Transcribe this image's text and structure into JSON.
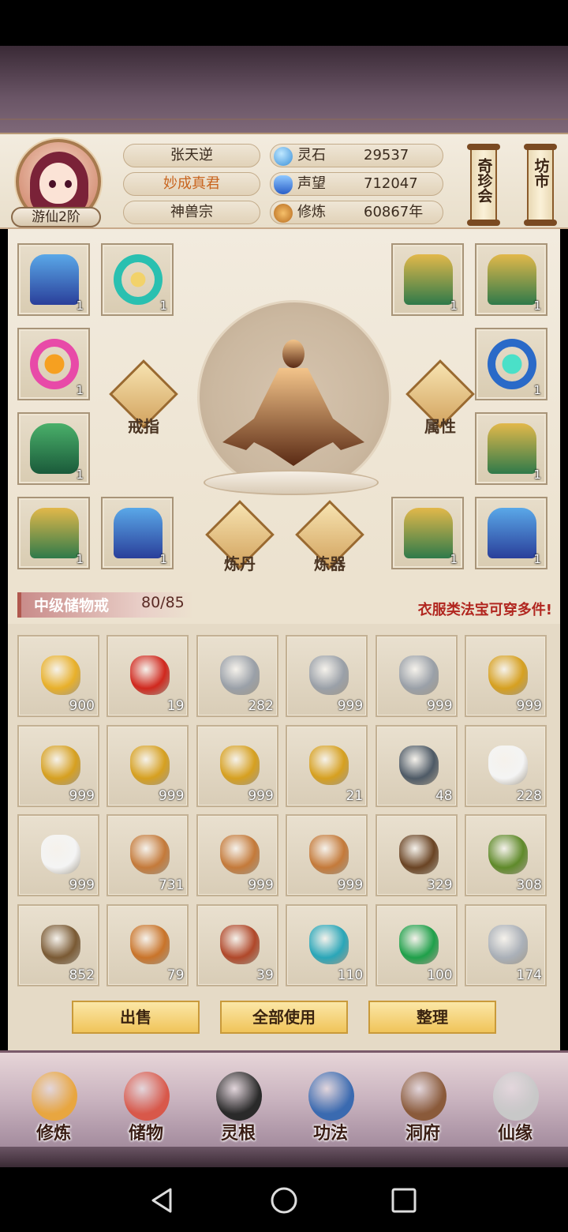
{
  "player": {
    "name": "张天逆",
    "title": "妙成真君",
    "sect": "神兽宗",
    "rank": "游仙2阶"
  },
  "stats": [
    {
      "label": "灵石",
      "value": "29537",
      "icon": "spirit-stone-icon",
      "color": "#4aa0e0"
    },
    {
      "label": "声望",
      "value": "712047",
      "icon": "prestige-crystal-icon",
      "color": "#3a7fd6"
    },
    {
      "label": "修炼",
      "value": "60867年",
      "icon": "cultivation-meditate-icon",
      "color": "#d8923a"
    }
  ],
  "scrolls": {
    "treasure_fair": "奇珍会",
    "market": "坊市"
  },
  "equipment": {
    "ring_label": "戒指",
    "attr_label": "属性",
    "alchemy_label": "炼丹",
    "forge_label": "炼器",
    "slots": [
      {
        "item": "blue-winged-armor-icon",
        "count": "1"
      },
      {
        "item": "gold-ring-icon",
        "count": "1"
      },
      {
        "item": "green-gold-armor-icon",
        "count": "1"
      },
      {
        "item": "green-gold-armor-icon",
        "count": "1"
      },
      {
        "item": "fire-ring-icon",
        "count": "1"
      },
      {
        "item": "blue-jade-ring-icon",
        "count": "1"
      },
      {
        "item": "leaf-robe-icon",
        "count": "1"
      },
      {
        "item": "green-gold-armor-icon",
        "count": "1"
      },
      {
        "item": "green-gold-armor-icon",
        "count": "1"
      },
      {
        "item": "blue-winged-armor-icon",
        "count": "1"
      },
      {
        "item": "green-gold-armor-icon",
        "count": "1"
      },
      {
        "item": "blue-winged-armor-icon",
        "count": "1"
      }
    ]
  },
  "bag": {
    "name": "中级储物戒",
    "capacity": "80/85",
    "hint": "衣服类法宝可穿多件!"
  },
  "items": [
    {
      "item": "gold-talisman-gem-icon",
      "count": "900",
      "color": "#e8b02a"
    },
    {
      "item": "red-orb-icon",
      "count": "19",
      "color": "#d0281e"
    },
    {
      "item": "silver-ore-icon",
      "count": "282",
      "color": "#9aa0a8"
    },
    {
      "item": "silver-ore-icon",
      "count": "999",
      "color": "#9aa0a8"
    },
    {
      "item": "silver-ore-icon",
      "count": "999",
      "color": "#9aa0a8"
    },
    {
      "item": "gold-ore-icon",
      "count": "999",
      "color": "#d6a020"
    },
    {
      "item": "gold-ore-icon",
      "count": "999",
      "color": "#d6a020"
    },
    {
      "item": "gold-ore-icon",
      "count": "999",
      "color": "#d6a020"
    },
    {
      "item": "gold-ore-icon",
      "count": "999",
      "color": "#d6a020"
    },
    {
      "item": "gold-ore-icon",
      "count": "21",
      "color": "#d6a020"
    },
    {
      "item": "dark-iron-icon",
      "count": "48",
      "color": "#4e5a66"
    },
    {
      "item": "white-flower-icon",
      "count": "228",
      "color": "#f4f4f4"
    },
    {
      "item": "white-flower-icon",
      "count": "999",
      "color": "#f4f4f4"
    },
    {
      "item": "ginseng-root-icon",
      "count": "731",
      "color": "#c47a3a"
    },
    {
      "item": "ginseng-root-icon",
      "count": "999",
      "color": "#c47a3a"
    },
    {
      "item": "ginseng-root-icon",
      "count": "999",
      "color": "#c47a3a"
    },
    {
      "item": "herb-root-icon",
      "count": "329",
      "color": "#6a4424"
    },
    {
      "item": "flowering-herb-icon",
      "count": "308",
      "color": "#5f8a2a"
    },
    {
      "item": "berry-branch-icon",
      "count": "852",
      "color": "#7a5a34"
    },
    {
      "item": "caterpillar-fungus-icon",
      "count": "79",
      "color": "#c9742a"
    },
    {
      "item": "red-crystal-icon",
      "count": "39",
      "color": "#b0482a"
    },
    {
      "item": "cyan-crystal-icon",
      "count": "110",
      "color": "#2aa6b8"
    },
    {
      "item": "green-crystal-icon",
      "count": "100",
      "color": "#1fa04a"
    },
    {
      "item": "silver-crystal-icon",
      "count": "174",
      "color": "#aab0b8"
    }
  ],
  "actions": {
    "sell": "出售",
    "use_all": "全部使用",
    "sort": "整理"
  },
  "nav": [
    {
      "label": "修炼",
      "icon": "meditating-monk-icon"
    },
    {
      "label": "储物",
      "icon": "treasure-pouch-icon"
    },
    {
      "label": "灵根",
      "icon": "spirit-root-orb-icon"
    },
    {
      "label": "功法",
      "icon": "scripture-book-icon"
    },
    {
      "label": "洞府",
      "icon": "cave-dwelling-icon"
    },
    {
      "label": "仙缘",
      "icon": "gourd-yin-yang-icon"
    }
  ]
}
